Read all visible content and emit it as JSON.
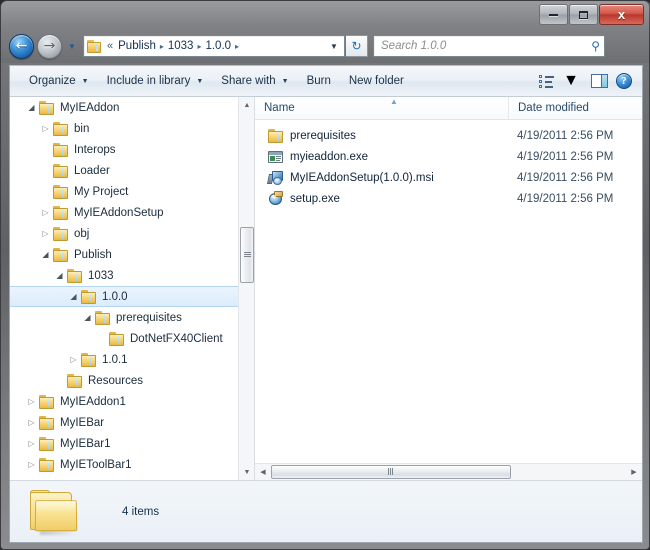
{
  "window": {
    "titlebar": {
      "minimize_label": "Minimize",
      "maximize_label": "Maximize",
      "close_label": "x"
    }
  },
  "addressbar": {
    "back_glyph": "←",
    "forward_glyph": "→",
    "history_glyph": "▼",
    "breadcrumb_leading": "«",
    "crumbs": [
      "Publish",
      "1033",
      "1.0.0"
    ],
    "separator_glyph": "▸",
    "dropdown_glyph": "▼",
    "refresh_glyph": "↻",
    "search": {
      "placeholder": "Search 1.0.0",
      "value": "",
      "icon_glyph": "⚲"
    }
  },
  "commandbar": {
    "items": [
      {
        "label": "Organize",
        "has_caret": true
      },
      {
        "label": "Include in library",
        "has_caret": true
      },
      {
        "label": "Share with",
        "has_caret": true
      },
      {
        "label": "Burn",
        "has_caret": false
      },
      {
        "label": "New folder",
        "has_caret": false
      }
    ],
    "view_caret_glyph": "▼",
    "help_glyph": "?"
  },
  "navigation_tree": {
    "items": [
      {
        "label": "MyIEAddon",
        "indent": 3,
        "expander": "open",
        "selected": false
      },
      {
        "label": "bin",
        "indent": 4,
        "expander": "closed",
        "selected": false
      },
      {
        "label": "Interops",
        "indent": 4,
        "expander": "none",
        "selected": false
      },
      {
        "label": "Loader",
        "indent": 4,
        "expander": "none",
        "selected": false
      },
      {
        "label": "My Project",
        "indent": 4,
        "expander": "none",
        "selected": false
      },
      {
        "label": "MyIEAddonSetup",
        "indent": 4,
        "expander": "closed",
        "selected": false
      },
      {
        "label": "obj",
        "indent": 4,
        "expander": "closed",
        "selected": false
      },
      {
        "label": "Publish",
        "indent": 4,
        "expander": "open",
        "selected": false
      },
      {
        "label": "1033",
        "indent": 5,
        "expander": "open",
        "selected": false
      },
      {
        "label": "1.0.0",
        "indent": 6,
        "expander": "open",
        "selected": true
      },
      {
        "label": "prerequisites",
        "indent": 7,
        "expander": "open",
        "selected": false
      },
      {
        "label": "DotNetFX40Client",
        "indent": 8,
        "expander": "none",
        "selected": false
      },
      {
        "label": "1.0.1",
        "indent": 6,
        "expander": "closed",
        "selected": false
      },
      {
        "label": "Resources",
        "indent": 5,
        "expander": "none",
        "selected": false
      },
      {
        "label": "MyIEAddon1",
        "indent": 3,
        "expander": "closed",
        "selected": false
      },
      {
        "label": "MyIEBar",
        "indent": 3,
        "expander": "closed",
        "selected": false
      },
      {
        "label": "MyIEBar1",
        "indent": 3,
        "expander": "closed",
        "selected": false
      },
      {
        "label": "MyIEToolBar1",
        "indent": 3,
        "expander": "closed",
        "selected": false
      }
    ],
    "expander_open_glyph": "◢",
    "expander_closed_glyph": "▷",
    "scroll_up_glyph": "▲",
    "scroll_down_glyph": "▼"
  },
  "file_list": {
    "columns": [
      {
        "key": "name",
        "label": "Name"
      },
      {
        "key": "date",
        "label": "Date modified"
      }
    ],
    "sort_glyph": "▲",
    "rows": [
      {
        "name": "prerequisites",
        "date": "4/19/2011 2:56 PM",
        "icon": "folder-icon"
      },
      {
        "name": "myieaddon.exe",
        "date": "4/19/2011 2:56 PM",
        "icon": "application-exe-icon"
      },
      {
        "name": "MyIEAddonSetup(1.0.0).msi",
        "date": "4/19/2011 2:56 PM",
        "icon": "msi-installer-icon"
      },
      {
        "name": "setup.exe",
        "date": "4/19/2011 2:56 PM",
        "icon": "setup-bootstrapper-icon"
      }
    ],
    "hscroll_left_glyph": "◀",
    "hscroll_right_glyph": "▶"
  },
  "statusbar": {
    "item_count_text": "4 items"
  },
  "colors": {
    "selection_blue": "#dcecfb",
    "selection_border": "#b4d5f0",
    "accent_blue": "#2a6db5",
    "close_red": "#b8382c",
    "folder_yellow": "#f3c95f",
    "window_bg": "#ffffff"
  }
}
